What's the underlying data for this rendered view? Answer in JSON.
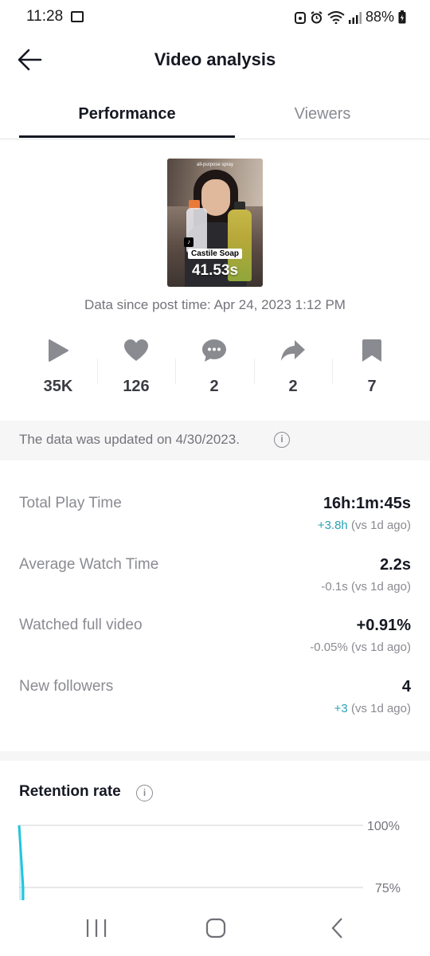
{
  "status_bar": {
    "time": "11:28",
    "battery": "88%",
    "icons": [
      "image-icon",
      "notification-icon",
      "alarm-icon",
      "wifi-icon",
      "signal-icon",
      "battery-icon"
    ]
  },
  "header": {
    "title": "Video analysis",
    "back_icon": "arrow-left-icon"
  },
  "tabs": [
    {
      "label": "Performance",
      "active": true
    },
    {
      "label": "Viewers",
      "active": false
    }
  ],
  "video": {
    "caption_top": "all-purpose spray",
    "overlay_label": "Castile Soap",
    "duration": "41.53s"
  },
  "data_since": "Data since post time: Apr 24, 2023 1:12 PM",
  "metrics": [
    {
      "icon": "play-icon",
      "value": "35K"
    },
    {
      "icon": "heart-icon",
      "value": "126"
    },
    {
      "icon": "comment-icon",
      "value": "2"
    },
    {
      "icon": "share-icon",
      "value": "2"
    },
    {
      "icon": "bookmark-icon",
      "value": "7"
    }
  ],
  "updated_notice": "The data was updated on 4/30/2023.",
  "stats": [
    {
      "label": "Total Play Time",
      "value": "16h:1m:45s",
      "delta": "+3.8h",
      "delta_suffix": "(vs 1d ago)",
      "delta_dir": "up"
    },
    {
      "label": "Average Watch Time",
      "value": "2.2s",
      "delta": "-0.1s",
      "delta_suffix": "(vs 1d ago)",
      "delta_dir": "down"
    },
    {
      "label": "Watched full video",
      "value": "+0.91%",
      "delta": "-0.05%",
      "delta_suffix": "(vs 1d ago)",
      "delta_dir": "down"
    },
    {
      "label": "New followers",
      "value": "4",
      "delta": "+3",
      "delta_suffix": "(vs 1d ago)",
      "delta_dir": "up"
    }
  ],
  "retention": {
    "title": "Retention rate",
    "y_labels": [
      "100%",
      "75%"
    ]
  },
  "colors": {
    "accent": "#2ba0b8",
    "chart_line": "#20c4e0",
    "text_primary": "#161823",
    "text_secondary": "#8a8b91"
  },
  "chart_data": {
    "type": "line",
    "title": "Retention rate",
    "ylim": [
      75,
      100
    ],
    "yticks": [
      100,
      75
    ],
    "series": [
      {
        "values": [
          100,
          75
        ]
      }
    ]
  },
  "nav": {
    "icons": [
      "recents-icon",
      "home-icon",
      "back-icon"
    ]
  }
}
